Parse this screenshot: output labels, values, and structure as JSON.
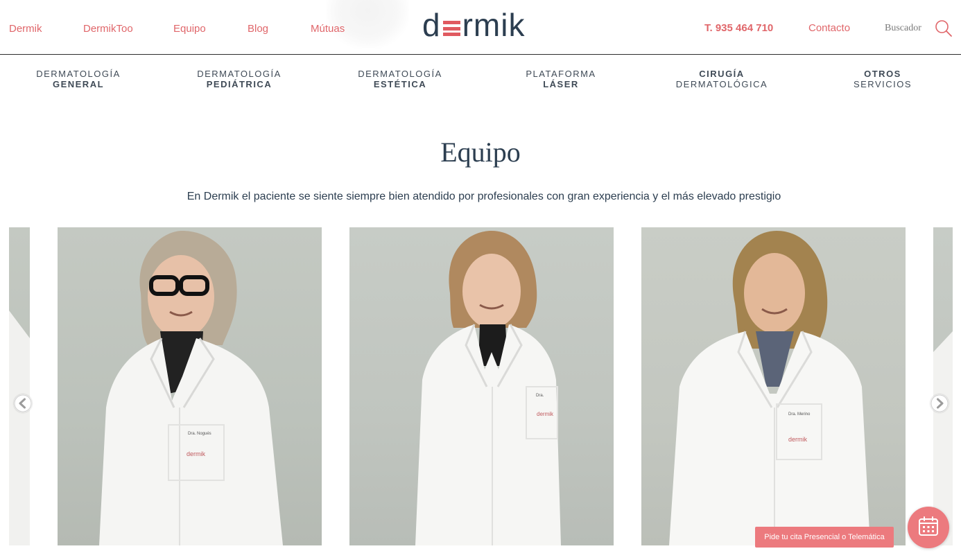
{
  "header": {
    "nav": [
      {
        "label": "Dermik"
      },
      {
        "label": "DermikToo"
      },
      {
        "label": "Equipo"
      },
      {
        "label": "Blog"
      },
      {
        "label": "Mútuas"
      }
    ],
    "logo": {
      "prefix": "d",
      "suffix": "rmik"
    },
    "phone": "T. 935 464 710",
    "contact": "Contacto",
    "search_label": "Buscador",
    "search_icon": "search-icon"
  },
  "services": [
    {
      "line1": "DERMATOLOGÍA",
      "line2": "GENERAL"
    },
    {
      "line1": "DERMATOLOGÍA",
      "line2": "PEDIÁTRICA"
    },
    {
      "line1": "DERMATOLOGÍA",
      "line2": "ESTÉTICA"
    },
    {
      "line1": "PLATAFORMA",
      "line2": "LÁSER"
    },
    {
      "line1": "CIRUGÍA",
      "line2": "DERMATOLÓGICA"
    },
    {
      "line1": "OTROS",
      "line2": "SERVICIOS"
    }
  ],
  "page": {
    "title": "Equipo",
    "subtitle": "En Dermik el paciente se siente siempre bien atendido por profesionales con gran experiencia y el más elevado prestigio"
  },
  "carousel": {
    "badges": [
      "Dra. Nogués",
      "Dra. ",
      "Dra. Merino"
    ],
    "coat_logo": "dermik",
    "prev_icon": "chevron-left-icon",
    "next_icon": "chevron-right-icon"
  },
  "appointment": {
    "label": "Pide tu cita Presencial o Telemática",
    "icon": "calendar-icon"
  },
  "colors": {
    "accent": "#e0666a",
    "button": "#ec7a7e",
    "text_dark": "#2c3e50"
  }
}
